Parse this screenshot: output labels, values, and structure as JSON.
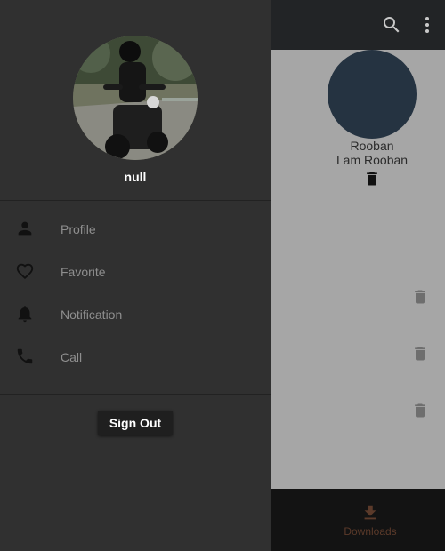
{
  "colors": {
    "appbar": "#222426",
    "content_scrim": "#a6a6a6",
    "drawer": "#303030",
    "avatar": "#253341",
    "downloads_accent": "#5b3a2a"
  },
  "appbar": {
    "actions": [
      {
        "icon": "search-icon"
      },
      {
        "icon": "more-vert-icon"
      }
    ]
  },
  "content": {
    "user_name": "Rooban",
    "user_status": "I am Rooban",
    "delete_icons": [
      "delete-icon",
      "delete-icon",
      "delete-icon",
      "delete-icon"
    ]
  },
  "bottom_nav": {
    "downloads_label": "Downloads",
    "downloads_icon": "download-icon"
  },
  "drawer": {
    "user_name": "null",
    "menu": [
      {
        "label": "Profile",
        "icon": "person-icon"
      },
      {
        "label": "Favorite",
        "icon": "heart-icon"
      },
      {
        "label": "Notification",
        "icon": "bell-icon"
      },
      {
        "label": "Call",
        "icon": "phone-icon"
      }
    ],
    "sign_out_label": "Sign Out"
  }
}
